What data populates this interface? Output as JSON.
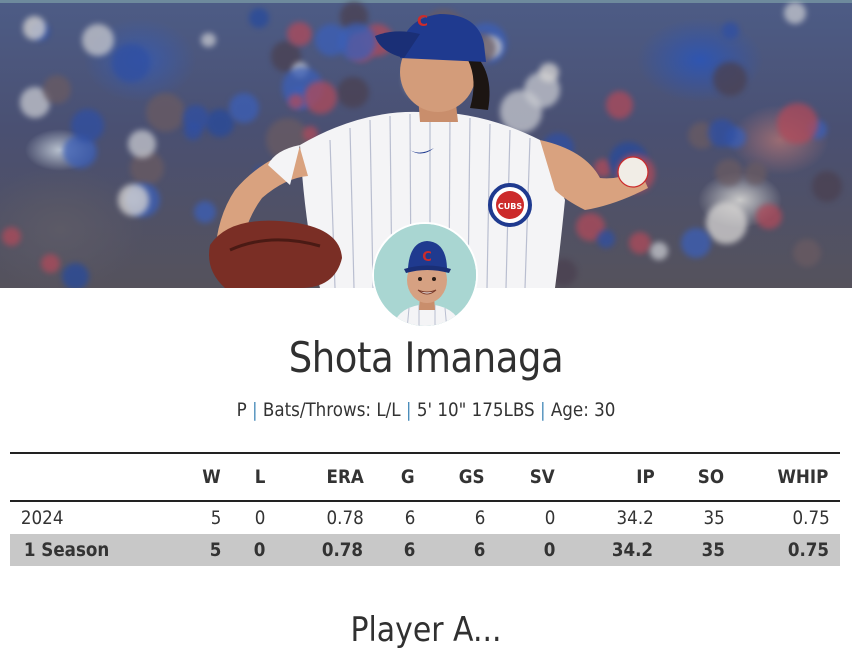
{
  "player": {
    "name": "Shota Imanaga",
    "position": "P",
    "bats_throws": "Bats/Throws: L/L",
    "height_weight": "5' 10\" 175LBS",
    "age": "Age: 30",
    "separator": "|"
  },
  "hero": {
    "cap_logo": "C",
    "jersey_logo": "CUBS"
  },
  "stats_table": {
    "headers": [
      "",
      "W",
      "L",
      "ERA",
      "G",
      "GS",
      "SV",
      "IP",
      "SO",
      "WHIP"
    ],
    "rows": [
      [
        "2024",
        "5",
        "0",
        "0.78",
        "6",
        "6",
        "0",
        "34.2",
        "35",
        "0.75"
      ]
    ],
    "total": [
      "1 Season",
      "5",
      "0",
      "0.78",
      "6",
      "6",
      "0",
      "34.2",
      "35",
      "0.75"
    ]
  },
  "next_section": {
    "heading": "Player A..."
  },
  "colors": {
    "separator": "#4b8dbb",
    "total_row_bg": "#c8c8c8",
    "avatar_bg": "#a9d6d2",
    "cubs_blue": "#1f3a8f",
    "cubs_red": "#cc2b2b"
  }
}
